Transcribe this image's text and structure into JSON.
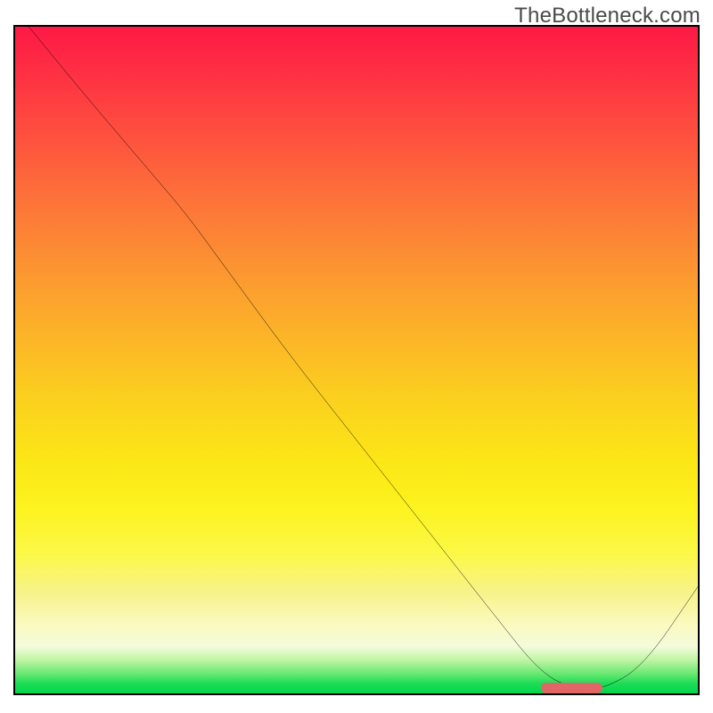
{
  "watermark": "TheBottleneck.com",
  "colors": {
    "border": "#000000",
    "curve": "#000000",
    "marker": "#e16666",
    "gradient_stops": [
      "#fe1946",
      "#fe3043",
      "#fd6f3a",
      "#fca12e",
      "#fbce1f",
      "#fbe616",
      "#fdf31e",
      "#fcf847",
      "#f7f38c",
      "#fbfac3",
      "#f3fbda",
      "#bff5a3",
      "#6be873",
      "#1edc56",
      "#00d64d"
    ]
  },
  "chart_data": {
    "type": "line",
    "title": "",
    "xlabel": "",
    "ylabel": "",
    "xlim": [
      0,
      100
    ],
    "ylim": [
      0,
      100
    ],
    "grid": false,
    "legend": false,
    "note": "x and y are read in percent of the plotting rectangle. y = value (100 = top of box, 0 = bottom).",
    "series": [
      {
        "name": "bottleneck-curve",
        "x": [
          2,
          10,
          20,
          25,
          30,
          40,
          50,
          60,
          70,
          77,
          82,
          86,
          92,
          100
        ],
        "y": [
          100,
          90,
          78,
          72,
          65,
          51,
          38,
          25,
          12,
          3,
          0.6,
          0.6,
          4,
          16
        ]
      }
    ],
    "marker": {
      "name": "optimal-range",
      "x_start": 77,
      "x_end": 86,
      "y": 0.8
    }
  }
}
